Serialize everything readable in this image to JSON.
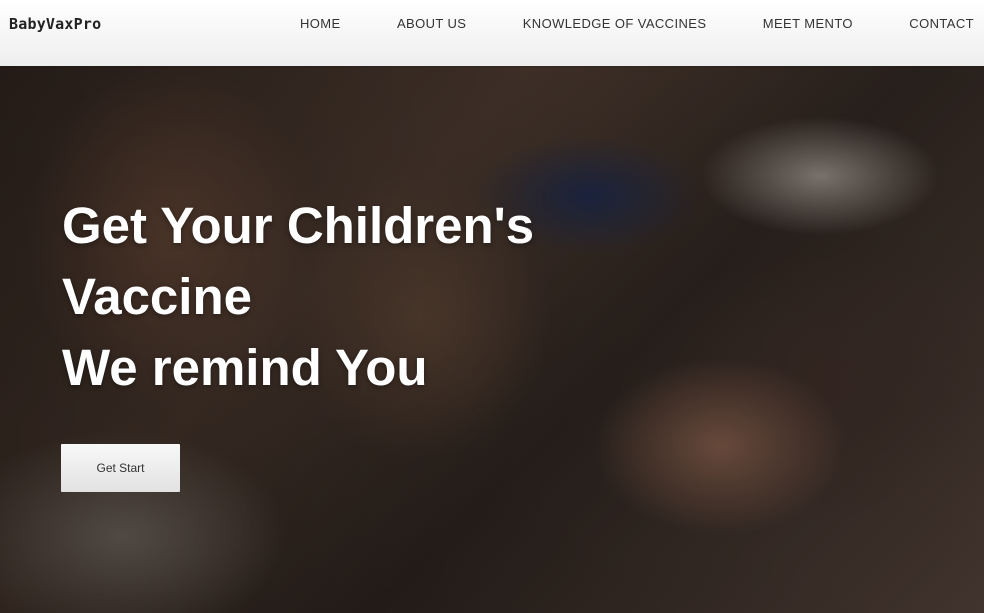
{
  "header": {
    "brand": "BabyVaxPro",
    "nav": [
      {
        "label": "HOME"
      },
      {
        "label": "ABOUT US"
      },
      {
        "label": "KNOWLEDGE OF VACCINES"
      },
      {
        "label": "MEET MENTO"
      },
      {
        "label": "CONTACT"
      }
    ]
  },
  "hero": {
    "heading_lines": [
      "Get Your Children's",
      "Vaccine",
      "We remind You"
    ],
    "cta_label": "Get Start"
  }
}
